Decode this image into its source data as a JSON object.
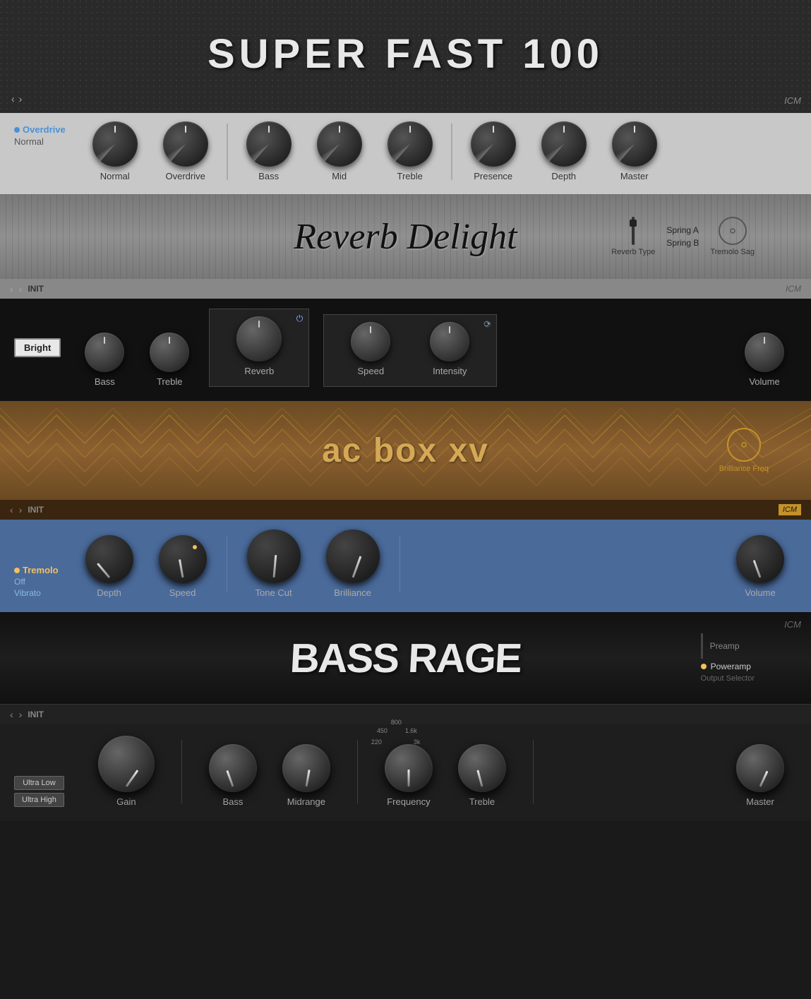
{
  "superfast": {
    "title": "SUPER FAST 100",
    "icm": "ICM"
  },
  "knobs_section": {
    "overdrive_label": "Overdrive",
    "normal_label": "Normal",
    "knobs": [
      {
        "label": "Normal"
      },
      {
        "label": "Overdrive"
      },
      {
        "label": "Bass"
      },
      {
        "label": "Mid"
      },
      {
        "label": "Treble"
      },
      {
        "label": "Presence"
      },
      {
        "label": "Depth"
      },
      {
        "label": "Master"
      }
    ]
  },
  "reverb_delight": {
    "title": "Reverb Delight",
    "spring_a": "Spring A",
    "spring_b": "Spring B",
    "reverb_type_label": "Reverb Type",
    "tremolo_sag_label": "Tremolo Sag",
    "nav_label": "INIT",
    "icm": "ICM",
    "controls": {
      "bright_label": "Bright",
      "knobs": [
        {
          "label": "Bass"
        },
        {
          "label": "Treble"
        },
        {
          "label": "Reverb"
        },
        {
          "label": "Speed"
        },
        {
          "label": "Intensity"
        },
        {
          "label": "Volume"
        }
      ]
    }
  },
  "acbox": {
    "title": "ac box xv",
    "brilliance_freq_label": "Brilliance Freq",
    "nav_label": "INIT",
    "icm": "ICM",
    "controls": {
      "tremolo_label": "Tremolo",
      "off_label": "Off",
      "vibrato_label": "Vibrato",
      "knobs": [
        {
          "label": "Depth"
        },
        {
          "label": "Speed"
        },
        {
          "label": "Tone Cut"
        },
        {
          "label": "Brilliance"
        },
        {
          "label": "Volume"
        }
      ]
    }
  },
  "bassrage": {
    "title": "BASS RAGE",
    "icm": "ICM",
    "preamp_label": "Preamp",
    "poweramp_label": "Poweramp",
    "output_selector_label": "Output Selector",
    "nav_label": "INIT",
    "controls": {
      "ultra_low_label": "Ultra Low",
      "ultra_high_label": "Ultra High",
      "freq_labels": [
        "220",
        "450",
        "800",
        "1.6k",
        "3k"
      ],
      "knobs": [
        {
          "label": "Gain"
        },
        {
          "label": "Bass"
        },
        {
          "label": "Midrange"
        },
        {
          "label": "Frequency"
        },
        {
          "label": "Treble"
        },
        {
          "label": "Master"
        }
      ]
    }
  },
  "nav": {
    "prev": "‹",
    "next": "›"
  }
}
